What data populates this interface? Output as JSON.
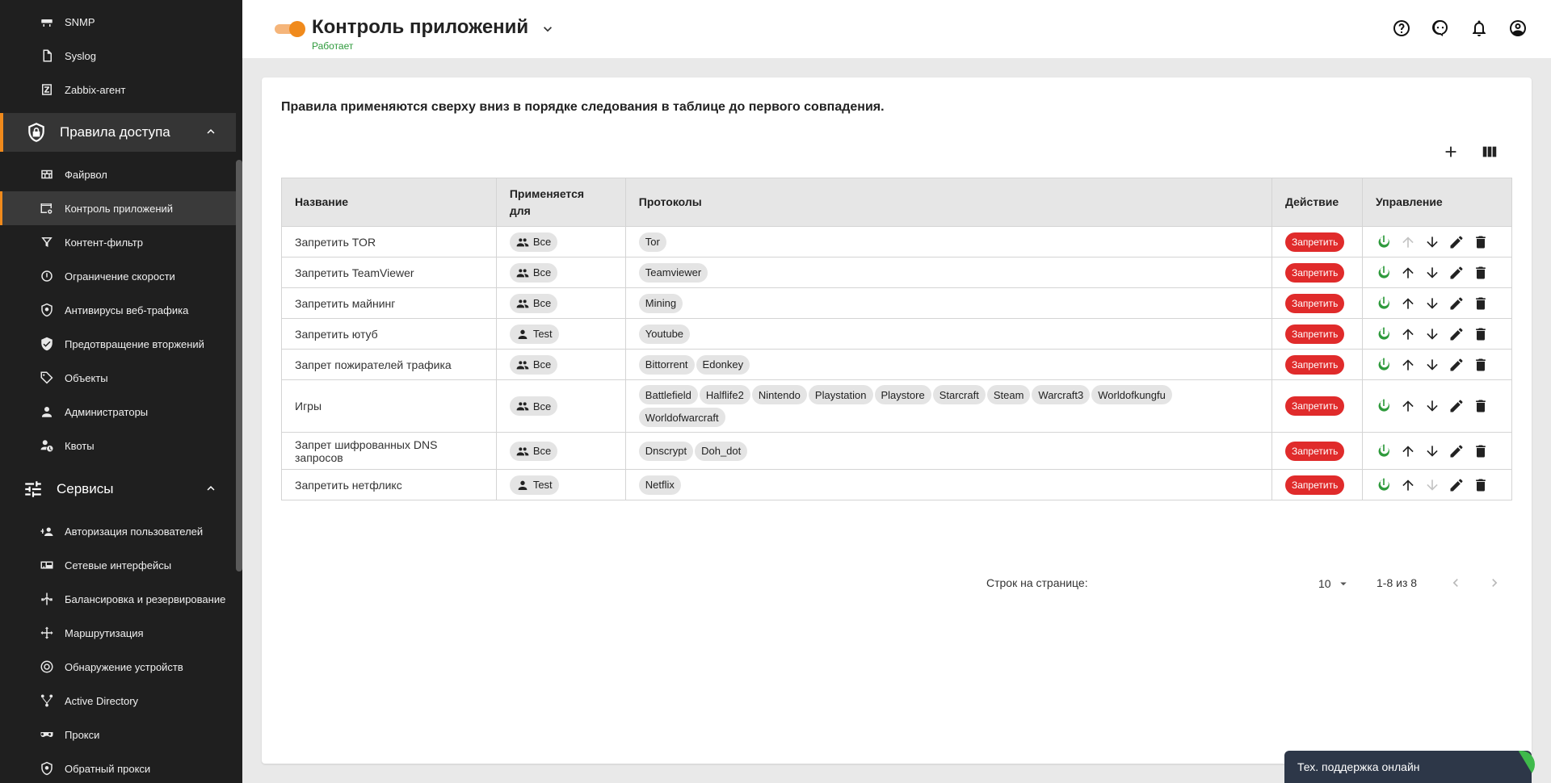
{
  "sidebar": {
    "items_top": [
      {
        "label": "SNMP",
        "icon": "network-device-icon"
      },
      {
        "label": "Syslog",
        "icon": "file-icon"
      },
      {
        "label": "Zabbix-агент",
        "icon": "zabbix-icon"
      }
    ],
    "group_access": {
      "label": "Правила доступа",
      "icon": "shield-lock-icon"
    },
    "items_access": [
      {
        "label": "Файрвол",
        "icon": "brick-wall-icon"
      },
      {
        "label": "Контроль приложений",
        "icon": "app-control-icon"
      },
      {
        "label": "Контент-фильтр",
        "icon": "filter-icon"
      },
      {
        "label": "Ограничение скорости",
        "icon": "speed-icon"
      },
      {
        "label": "Антивирусы веб-трафика",
        "icon": "shield-virus-icon"
      },
      {
        "label": "Предотвращение вторжений",
        "icon": "shield-check-icon"
      },
      {
        "label": "Объекты",
        "icon": "tag-icon"
      },
      {
        "label": "Администраторы",
        "icon": "admin-icon"
      },
      {
        "label": "Квоты",
        "icon": "quota-icon"
      }
    ],
    "group_services": {
      "label": "Сервисы",
      "icon": "sliders-icon"
    },
    "items_services": [
      {
        "label": "Авторизация пользователей",
        "icon": "user-auth-icon"
      },
      {
        "label": "Сетевые интерфейсы",
        "icon": "network-card-icon"
      },
      {
        "label": "Балансировка и резервирование",
        "icon": "balance-icon"
      },
      {
        "label": "Маршрутизация",
        "icon": "routing-icon"
      },
      {
        "label": "Обнаружение устройств",
        "icon": "radar-icon"
      },
      {
        "label": "Active Directory",
        "icon": "directory-icon"
      },
      {
        "label": "Прокси",
        "icon": "mask-icon"
      },
      {
        "label": "Обратный прокси",
        "icon": "shield-virus-icon"
      }
    ]
  },
  "header": {
    "title": "Контроль приложений",
    "status": "Работает"
  },
  "main": {
    "description": "Правила применяются сверху вниз в порядке следования в таблице до первого совпадения.",
    "columns": [
      "Название",
      "Применяется для",
      "Протоколы",
      "Действие",
      "Управление"
    ],
    "rows": [
      {
        "name": "Запретить TOR",
        "applies": "Все",
        "applies_icon": "group-icon",
        "protocols": [
          "Tor"
        ],
        "action": "Запретить",
        "up_disabled": true,
        "down_disabled": false
      },
      {
        "name": "Запретить TeamViewer",
        "applies": "Все",
        "applies_icon": "group-icon",
        "protocols": [
          "Teamviewer"
        ],
        "action": "Запретить",
        "up_disabled": false,
        "down_disabled": false
      },
      {
        "name": "Запретить майнинг",
        "applies": "Все",
        "applies_icon": "group-icon",
        "protocols": [
          "Mining"
        ],
        "action": "Запретить",
        "up_disabled": false,
        "down_disabled": false
      },
      {
        "name": "Запретить ютуб",
        "applies": "Test",
        "applies_icon": "person-icon",
        "protocols": [
          "Youtube"
        ],
        "action": "Запретить",
        "up_disabled": false,
        "down_disabled": false
      },
      {
        "name": "Запрет пожирателей трафика",
        "applies": "Все",
        "applies_icon": "group-icon",
        "protocols": [
          "Bittorrent",
          "Edonkey"
        ],
        "action": "Запретить",
        "up_disabled": false,
        "down_disabled": false
      },
      {
        "name": "Игры",
        "applies": "Все",
        "applies_icon": "group-icon",
        "protocols": [
          "Battlefield",
          "Halflife2",
          "Nintendo",
          "Playstation",
          "Playstore",
          "Starcraft",
          "Steam",
          "Warcraft3",
          "Worldofkungfu",
          "Worldofwarcraft"
        ],
        "action": "Запретить",
        "up_disabled": false,
        "down_disabled": false
      },
      {
        "name": "Запрет шифрованных DNS запросов",
        "applies": "Все",
        "applies_icon": "group-icon",
        "protocols": [
          "Dnscrypt",
          "Doh_dot"
        ],
        "action": "Запретить",
        "up_disabled": false,
        "down_disabled": false
      },
      {
        "name": "Запретить нетфликс",
        "applies": "Test",
        "applies_icon": "person-icon",
        "protocols": [
          "Netflix"
        ],
        "action": "Запретить",
        "up_disabled": false,
        "down_disabled": true
      }
    ],
    "pagination": {
      "rows_label": "Строк на странице:",
      "rows_value": "10",
      "range": "1-8 из 8"
    }
  },
  "support": {
    "label": "Тех. поддержка онлайн"
  },
  "colors": {
    "accent": "#f08a1c",
    "deny": "#e02b2b",
    "enabled": "#2e9a3c",
    "sidebar": "#1f1f1f"
  }
}
